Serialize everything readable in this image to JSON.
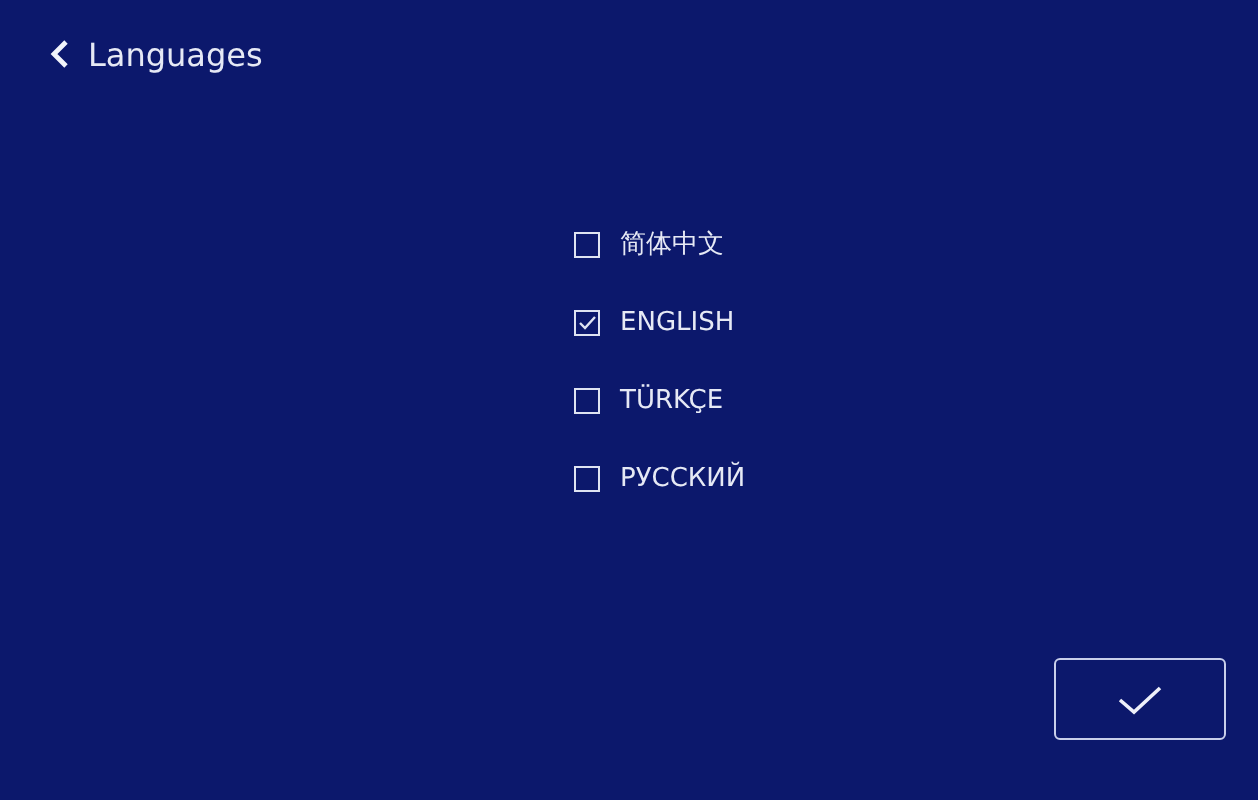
{
  "header": {
    "title": "Languages"
  },
  "languages": [
    {
      "label": "简体中文",
      "checked": false
    },
    {
      "label": "ENGLISH",
      "checked": true
    },
    {
      "label": "TÜRKÇE",
      "checked": false
    },
    {
      "label": "РУССКИЙ",
      "checked": false
    }
  ]
}
